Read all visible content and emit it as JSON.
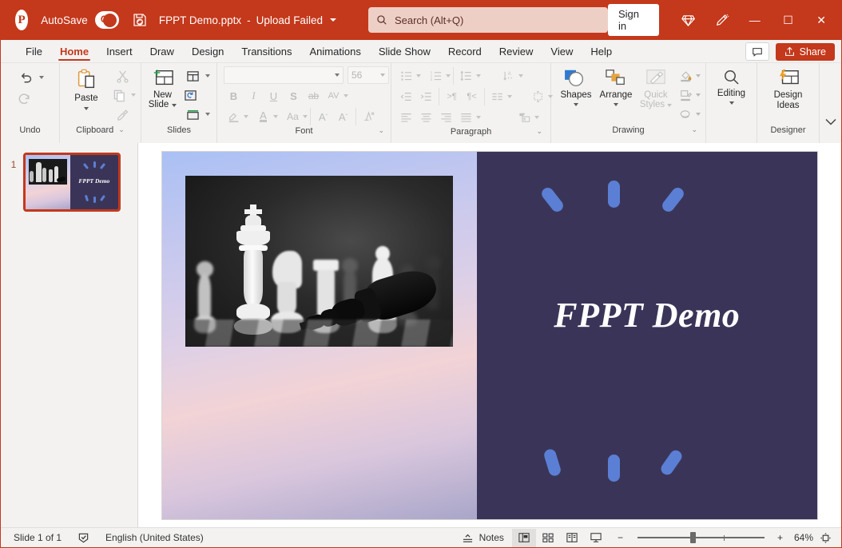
{
  "titlebar": {
    "app_icon": "powerpoint-logo-icon",
    "autosave_label": "AutoSave",
    "autosave_state": "On",
    "save_icon": "save-sync-icon",
    "document_title": "FPPT Demo.pptx",
    "title_separator": "-",
    "upload_status": "Upload Failed",
    "search_icon": "search-icon",
    "search_placeholder": "Search (Alt+Q)",
    "signin_label": "Sign in",
    "diamond_icon": "diamond-icon",
    "pen_icon": "pen-highlight-icon",
    "minimize_label": "—",
    "maximize_label": "☐",
    "close_label": "✕",
    "accent_color": "#c4381b",
    "search_bg": "#eecfc6"
  },
  "tabs": [
    {
      "label": "File",
      "active": false
    },
    {
      "label": "Home",
      "active": true
    },
    {
      "label": "Insert",
      "active": false
    },
    {
      "label": "Draw",
      "active": false
    },
    {
      "label": "Design",
      "active": false
    },
    {
      "label": "Transitions",
      "active": false
    },
    {
      "label": "Animations",
      "active": false
    },
    {
      "label": "Slide Show",
      "active": false
    },
    {
      "label": "Record",
      "active": false
    },
    {
      "label": "Review",
      "active": false
    },
    {
      "label": "View",
      "active": false
    },
    {
      "label": "Help",
      "active": false
    }
  ],
  "tabbar_right": {
    "comments_icon": "comment-icon",
    "share_icon": "share-icon",
    "share_label": "Share"
  },
  "ribbon": {
    "groups": [
      {
        "name": "Undo",
        "label": "Undo",
        "dialog_launcher": false
      },
      {
        "name": "Clipboard",
        "label": "Clipboard",
        "dialog_launcher": true
      },
      {
        "name": "Slides",
        "label": "Slides",
        "dialog_launcher": false
      },
      {
        "name": "Font",
        "label": "Font",
        "dialog_launcher": true
      },
      {
        "name": "Paragraph",
        "label": "Paragraph",
        "dialog_launcher": true
      },
      {
        "name": "Drawing",
        "label": "Drawing",
        "dialog_launcher": true
      },
      {
        "name": "Designer",
        "label": "Designer",
        "dialog_launcher": false
      }
    ],
    "undo": {
      "undo_icon": "undo-icon",
      "redo_icon": "redo-icon"
    },
    "clipboard": {
      "paste_label": "Paste",
      "paste_icon": "paste-icon",
      "cut_icon": "scissors-icon",
      "copy_icon": "copy-icon",
      "format_painter_icon": "format-painter-icon"
    },
    "slides": {
      "new_slide_label": "New\nSlide",
      "new_slide_line1": "New",
      "new_slide_line2": "Slide",
      "new_slide_icon": "new-slide-icon",
      "layout_icon": "layout-icon",
      "reset_icon": "reset-slide-icon",
      "section_icon": "section-icon"
    },
    "font": {
      "font_name_value": "",
      "font_size_value": "56",
      "bold_label": "B",
      "italic_label": "I",
      "underline_label": "U",
      "shadow_label": "S",
      "strikethrough_label": "ab",
      "char_spacing_label": "AV",
      "highlight_icon": "text-highlight-icon",
      "font_color_label": "A",
      "change_case_label": "Aa",
      "grow_font_label": "A",
      "shrink_font_label": "A",
      "clear_format_icon": "clear-formatting-icon"
    },
    "paragraph": {
      "bullets_icon": "bullets-icon",
      "numbering_icon": "numbering-icon",
      "line_spacing_icon": "line-spacing-icon",
      "text_direction_icon": "text-direction-icon",
      "decrease_indent_icon": "decrease-indent-icon",
      "increase_indent_icon": "increase-indent-icon",
      "rtl_icon": "rtl-text-icon",
      "ltr_icon": "ltr-text-icon",
      "columns_icon": "columns-icon",
      "align_text_icon": "align-text-vertical-icon",
      "align_left_icon": "align-left-icon",
      "align_center_icon": "align-center-icon",
      "align_right_icon": "align-right-icon",
      "justify_icon": "justify-icon",
      "smartart_icon": "convert-smartart-icon"
    },
    "drawing": {
      "shapes_label": "Shapes",
      "shapes_icon": "shapes-icon",
      "arrange_label": "Arrange",
      "arrange_icon": "arrange-icon",
      "quick_styles_line1": "Quick",
      "quick_styles_line2": "Styles",
      "quick_styles_icon": "quick-styles-icon",
      "shape_fill_icon": "shape-fill-icon",
      "shape_outline_icon": "shape-outline-icon",
      "shape_effects_icon": "shape-effects-icon"
    },
    "editing": {
      "editing_label": "Editing",
      "editing_icon": "search-magnifier-icon"
    },
    "designer": {
      "design_ideas_line1": "Design",
      "design_ideas_line2": "Ideas",
      "design_ideas_icon": "design-ideas-icon"
    },
    "collapse_icon": "collapse-ribbon-icon"
  },
  "thumbnails": [
    {
      "number": "1",
      "title": "FPPT Demo",
      "selected": true
    }
  ],
  "slide": {
    "title": "FPPT Demo",
    "photo_alt": "chess-pieces-photo",
    "right_panel_color": "#3a3558",
    "shape_color": "#5b7fd4",
    "gradient_start": "#aac0f4",
    "gradient_end": "#a9a6c9",
    "top_shapes": [
      {
        "name": "capsule-top-left",
        "rotation": -38
      },
      {
        "name": "capsule-top-center",
        "rotation": 0
      },
      {
        "name": "capsule-top-right",
        "rotation": 38
      }
    ],
    "bottom_shapes": [
      {
        "name": "capsule-bottom-left",
        "rotation": -17
      },
      {
        "name": "capsule-bottom-center",
        "rotation": 0
      },
      {
        "name": "capsule-bottom-right",
        "rotation": 35
      }
    ]
  },
  "status": {
    "slide_count": "Slide 1 of 1",
    "spelling_icon": "spell-check-icon",
    "language": "English (United States)",
    "notes_label": "Notes",
    "notes_icon": "notes-icon",
    "view_normal_icon": "normal-view-icon",
    "view_sorter_icon": "slide-sorter-icon",
    "view_reading_icon": "reading-view-icon",
    "view_slideshow_icon": "slideshow-view-icon",
    "zoom_out_label": "−",
    "zoom_in_label": "+",
    "zoom_level": "64%",
    "fit_icon": "fit-to-window-icon"
  }
}
